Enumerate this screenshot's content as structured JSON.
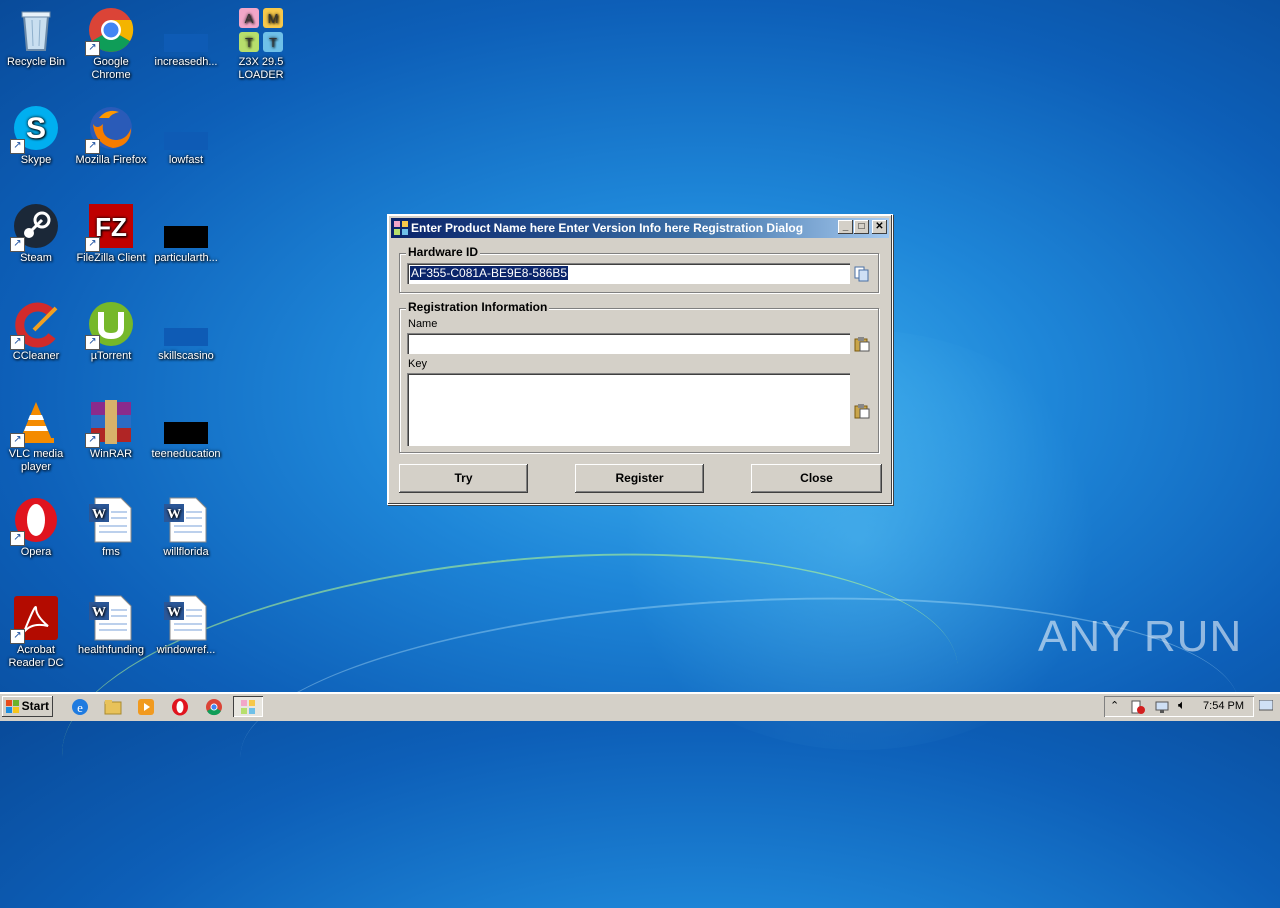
{
  "desktop": {
    "icons": [
      {
        "label": "Recycle Bin"
      },
      {
        "label": "Google\nChrome"
      },
      {
        "label": "increasedh..."
      },
      {
        "label": "Z3X 29.5\nLOADER"
      },
      {
        "label": "Skype"
      },
      {
        "label": "Mozilla Firefox"
      },
      {
        "label": "lowfast"
      },
      {
        "label": "Steam"
      },
      {
        "label": "FileZilla Client"
      },
      {
        "label": "particularth..."
      },
      {
        "label": "CCleaner"
      },
      {
        "label": "µTorrent"
      },
      {
        "label": "skillscasino"
      },
      {
        "label": "VLC media\nplayer"
      },
      {
        "label": "WinRAR"
      },
      {
        "label": "teeneducation"
      },
      {
        "label": "Opera"
      },
      {
        "label": "fms"
      },
      {
        "label": "willflorida"
      },
      {
        "label": "Acrobat\nReader DC"
      },
      {
        "label": "healthfunding"
      },
      {
        "label": "windowref..."
      }
    ],
    "z3x_letters": [
      "A",
      "M",
      "T",
      "T"
    ]
  },
  "dialog": {
    "title": "Enter Product Name here Enter Version Info here Registration Dialog",
    "hardware_group": "Hardware ID",
    "hardware_id": "AF355-C081A-BE9E8-586B5",
    "registration_group": "Registration Information",
    "name_label": "Name",
    "name_value": "",
    "key_label": "Key",
    "key_value": "",
    "buttons": {
      "try": "Try",
      "register": "Register",
      "close": "Close"
    }
  },
  "taskbar": {
    "start_label": "Start",
    "clock": "7:54 PM"
  },
  "watermark": "ANY  RUN",
  "colors": {
    "titlebar_start": "#0a246a",
    "titlebar_end": "#a6caf0",
    "face": "#d4d0c8"
  }
}
